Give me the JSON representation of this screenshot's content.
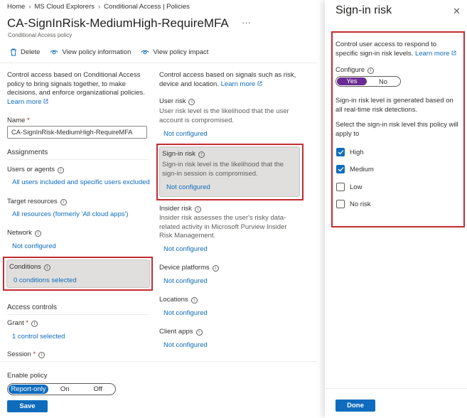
{
  "breadcrumb": [
    "Home",
    "MS Cloud Explorers",
    "Conditional Access | Policies"
  ],
  "policy": {
    "title": "CA-SignInRisk-MediumHigh-RequireMFA",
    "more": "···",
    "subtitle": "Conditional Access policy"
  },
  "toolbar": {
    "delete": "Delete",
    "view_info": "View policy information",
    "view_impact": "View policy impact"
  },
  "left_col": {
    "intro": "Control access based on Conditional Access policy to bring signals together, to make decisions, and enforce organizational policies.",
    "learn_more": "Learn more",
    "name_label": "Name",
    "required_mark": "*",
    "name_value": "CA-SignInRisk-MediumHigh-RequireMFA",
    "assignments": "Assignments",
    "users_label": "Users or agents",
    "users_value": "All users included and specific users excluded",
    "target_label": "Target resources",
    "target_value": "All resources (formerly 'All cloud apps')",
    "network_label": "Network",
    "network_value": "Not configured",
    "conditions_label": "Conditions",
    "conditions_value": "0 conditions selected",
    "access_controls": "Access controls",
    "grant_label": "Grant",
    "grant_value": "1 control selected",
    "session_label": "Session"
  },
  "right_col": {
    "intro": "Control access based on signals such as risk, device and location.",
    "learn_more": "Learn more",
    "user_risk_label": "User risk",
    "user_risk_desc": "User risk level is the likelihood that the user account is compromised.",
    "user_risk_value": "Not configured",
    "signin_risk_label": "Sign-in risk",
    "signin_risk_desc": "Sign-in risk level is the likelihood that the sign-in session is compromised.",
    "signin_risk_value": "Not configured",
    "insider_label": "Insider risk",
    "insider_desc": "Insider risk assesses the user's risky data-related activity in Microsoft Purview Insider Risk Management.",
    "insider_value": "Not configured",
    "device_label": "Device platforms",
    "device_value": "Not configured",
    "locations_label": "Locations",
    "locations_value": "Not configured",
    "client_label": "Client apps",
    "client_value": "Not configured"
  },
  "footer": {
    "enable_label": "Enable policy",
    "options": [
      "Report-only",
      "On",
      "Off"
    ],
    "selected": "Report-only",
    "save": "Save"
  },
  "panel": {
    "title": "Sign-in risk",
    "close": "✕",
    "intro": "Control user access to respond to specific sign-in risk levels.",
    "learn_more": "Learn more",
    "configure_label": "Configure",
    "configure_yes": "Yes",
    "configure_no": "No",
    "generated_text": "Sign-in risk level is generated based on all real-time risk detections.",
    "select_text": "Select the sign-in risk level this policy will apply to",
    "levels": [
      {
        "label": "High",
        "checked": true
      },
      {
        "label": "Medium",
        "checked": true
      },
      {
        "label": "Low",
        "checked": false
      },
      {
        "label": "No risk",
        "checked": false
      }
    ],
    "done": "Done"
  },
  "colors": {
    "accent": "#0f6cbd",
    "highlight": "#c42b30",
    "toggle_yes": "#6b2c91"
  }
}
